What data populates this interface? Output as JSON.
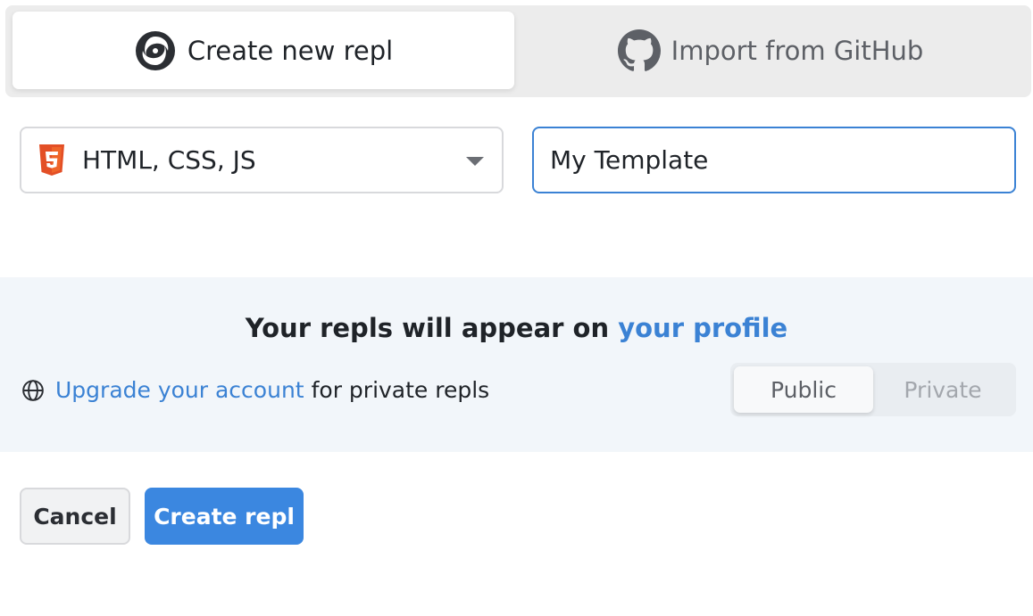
{
  "tabs": {
    "create": {
      "label": "Create new repl",
      "icon": "replit-spiral-icon"
    },
    "import": {
      "label": "Import from GitHub",
      "icon": "github-icon"
    }
  },
  "template_select": {
    "value": "HTML, CSS, JS",
    "icon": "html5-icon"
  },
  "title_input": {
    "value": "My Template"
  },
  "privacy": {
    "heading_prefix": "Your repls will appear on",
    "heading_link": "your profile",
    "upgrade_link": "Upgrade your account",
    "upgrade_suffix": "for private repls",
    "toggle": {
      "public_label": "Public",
      "private_label": "Private",
      "selected": "Public"
    }
  },
  "actions": {
    "cancel_label": "Cancel",
    "create_label": "Create repl"
  },
  "colors": {
    "accent": "#3b82d4",
    "primary_button": "#3b87e0",
    "html5": "#e34f26"
  }
}
